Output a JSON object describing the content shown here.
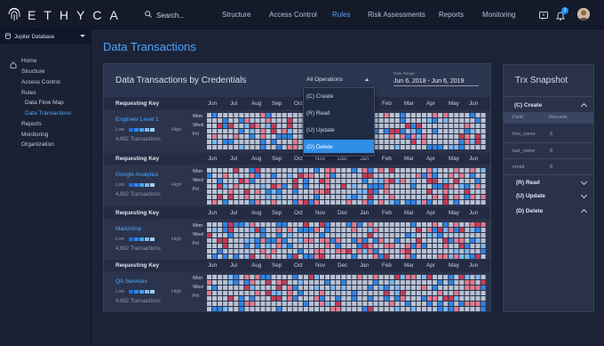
{
  "brand": "ETHYCA",
  "search_placeholder": "Search...",
  "nav": [
    "Structure",
    "Access Control",
    "Rules",
    "Risk Assessments",
    "Reports",
    "Monitoring"
  ],
  "nav_active": "Rules",
  "notification_count": "3",
  "database": "Jupiter Database",
  "sidebar": {
    "home": "Home",
    "structure": "Structure",
    "access_control": "Access Control",
    "rules": "Rules",
    "data_flow_map": "Data Flow Map",
    "data_transactions": "Data Transactions",
    "reports": "Reports",
    "monitoring": "Monitoring",
    "organization": "Organization"
  },
  "page_title": "Data Transactions",
  "panel_title": "Data Transactions by Credentials",
  "operations_select": "All Operations",
  "operations_options": [
    "(C) Create",
    "(R) Read",
    "(U) Update",
    "(D) Delete"
  ],
  "date_range_label": "Date Range",
  "date_range": "Jun 6, 2018 - Jun 6, 2019",
  "requesting_key_label": "Requesting Key",
  "months": [
    "Jun",
    "Jul",
    "Aug",
    "Sep",
    "Oct",
    "Nov",
    "Dec",
    "Jan",
    "Feb",
    "Mar",
    "Apr",
    "May",
    "Jun"
  ],
  "days": [
    "Mon",
    "Wed",
    "Fri"
  ],
  "scale_low": "Low",
  "scale_high": "High",
  "credentials": [
    {
      "name": "Engineer Level 1",
      "transactions": "4,892 Transactions"
    },
    {
      "name": "Google Analytics",
      "transactions": "4,892 Transactions"
    },
    {
      "name": "Mailchimp",
      "transactions": "4,892 Transactions"
    },
    {
      "name": "QA Services",
      "transactions": "4,892 Transactions"
    }
  ],
  "snapshot": {
    "title": "Trx Snapshot",
    "create": "(C) Create",
    "field_header": "Field",
    "records_header": "Records",
    "fields": [
      {
        "field": "first_name",
        "records": "8"
      },
      {
        "field": "last_name",
        "records": "8"
      },
      {
        "field": "email",
        "records": "8"
      }
    ],
    "read": "(R) Read",
    "update": "(U) Update",
    "delete": "(D) Delete"
  },
  "colors": {
    "accent": "#4ea6ff",
    "cell_empty": "#b9c2d3",
    "cell_blue": "#2e86e8",
    "cell_pink": "#e57a8c",
    "cell_red": "#c93a55"
  }
}
